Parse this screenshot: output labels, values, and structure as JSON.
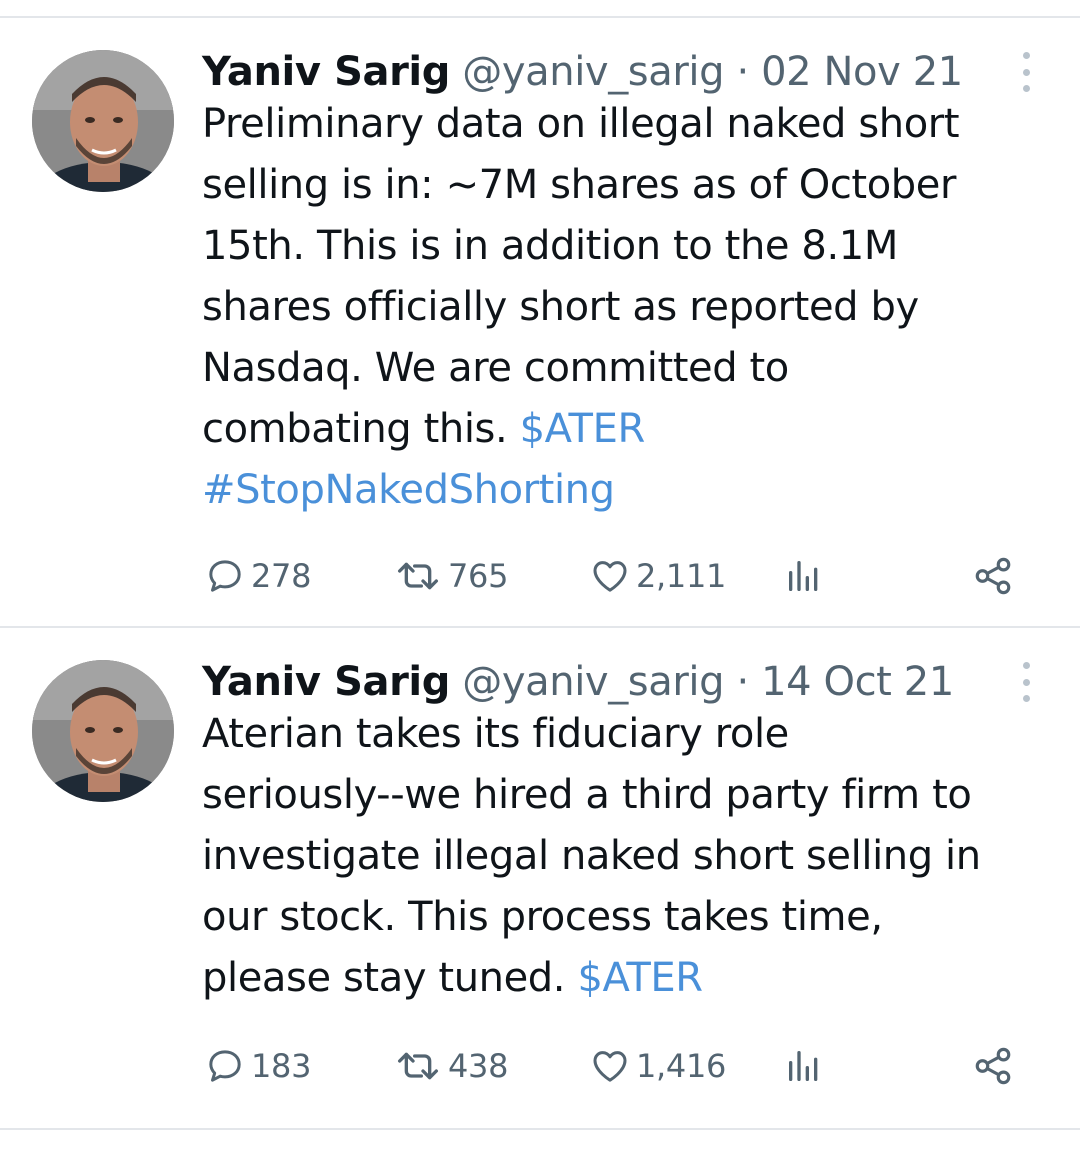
{
  "tweets": [
    {
      "name": "Yaniv Sarig",
      "handle": "@yaniv_sarig",
      "separator": "·",
      "date": "02 Nov 21",
      "text_lines": [
        "Preliminary data on illegal naked short",
        "selling is in: ~7M shares as of October",
        "15th. This is in addition to the 8.1M",
        "shares officially short as reported by",
        "Nasdaq. We are committed to",
        "combating this."
      ],
      "cashtag": "$ATER",
      "hashtag": "#StopNakedShorting",
      "replies": "278",
      "retweets": "765",
      "likes": "2,111",
      "icons": [
        "reply-icon",
        "retweet-icon",
        "like-icon",
        "views-icon",
        "share-icon"
      ]
    },
    {
      "name": "Yaniv Sarig",
      "handle": "@yaniv_sarig",
      "separator": "·",
      "date": "14 Oct 21",
      "text_lines": [
        "Aterian takes its fiduciary role",
        "seriously--we hired a third party firm to",
        "investigate illegal naked short selling in",
        "our stock. This process takes time,",
        "please stay tuned."
      ],
      "cashtag": "$ATER",
      "replies": "183",
      "retweets": "438",
      "likes": "1,416",
      "icons": [
        "reply-icon",
        "retweet-icon",
        "like-icon",
        "views-icon",
        "share-icon"
      ]
    }
  ],
  "colors": {
    "text": "#0f1419",
    "secondary": "#536471",
    "link": "#4a90d9",
    "divider": "#e3e6ea"
  }
}
